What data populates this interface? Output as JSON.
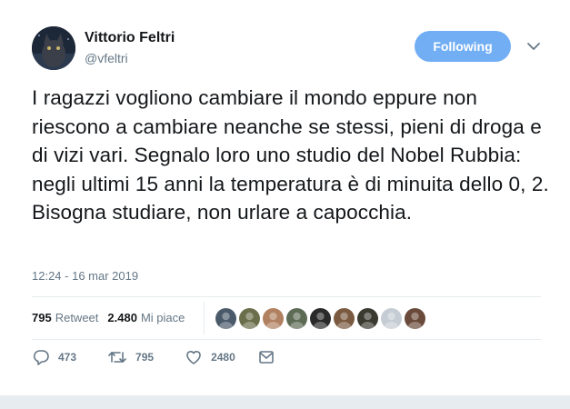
{
  "author": {
    "name": "Vittorio Feltri",
    "handle": "@vfeltri"
  },
  "follow_button": {
    "label": "Following",
    "color": "#71aef3"
  },
  "tweet": {
    "text": "I ragazzi vogliono cambiare il mondo eppure non riescono a cambiare neanche se stessi, pieni di droga e di vizi vari. Segnalo loro uno studio del Nobel Rubbia: negli ultimi 15 anni la temperatura è di minuita dello 0, 2. Bisogna studiare, non urlare a capocchia.",
    "timestamp": "12:24 - 16 mar 2019"
  },
  "stats": {
    "retweets_count": "795",
    "retweets_label": "Retweet",
    "likes_count": "2.480",
    "likes_label": "Mi piace"
  },
  "likers": [
    {
      "icon": "avatar-1",
      "color": "#4a5a6a"
    },
    {
      "icon": "avatar-2",
      "color": "#6b6e4a"
    },
    {
      "icon": "avatar-3",
      "color": "#b08060"
    },
    {
      "icon": "avatar-4",
      "color": "#5d6b55"
    },
    {
      "icon": "avatar-5",
      "color": "#2a2a2a"
    },
    {
      "icon": "avatar-6",
      "color": "#7a5a40"
    },
    {
      "icon": "avatar-7",
      "color": "#3a3a30"
    },
    {
      "icon": "avatar-8",
      "color": "#c5ccd3"
    },
    {
      "icon": "avatar-9",
      "color": "#6a4a3a"
    }
  ],
  "actions": {
    "replies": "473",
    "retweets": "795",
    "likes": "2480"
  }
}
